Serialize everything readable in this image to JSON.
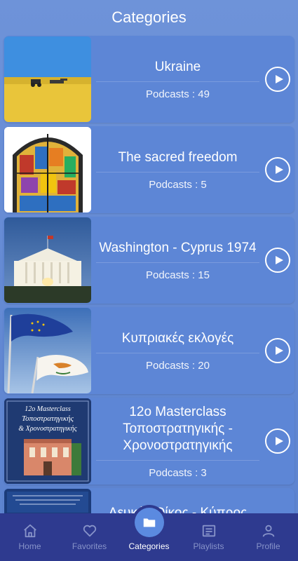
{
  "header": {
    "title": "Categories"
  },
  "categories": [
    {
      "title": "Ukraine",
      "count_label": "Podcasts : 49",
      "thumb": "ukraine-field"
    },
    {
      "title": "The sacred freedom",
      "count_label": "Podcasts : 5",
      "thumb": "stained-glass"
    },
    {
      "title": "Washington - Cyprus 1974",
      "count_label": "Podcasts : 15",
      "thumb": "white-house"
    },
    {
      "title": "Κυπριακές εκλογές",
      "count_label": "Podcasts : 20",
      "thumb": "flags"
    },
    {
      "title": "12ο Masterclass Τοποστρατηγικής - Χρονοστρατηγικής",
      "count_label": "Podcasts : 3",
      "thumb": "masterclass-cover",
      "thumb_text": {
        "line1": "12ο Masterclass",
        "line2": "Τοποστρατηγικής",
        "line3": "& Χρονοστρατηγικής"
      }
    },
    {
      "title": "Λευκός Οίκος - Κύπρος",
      "count_label": "",
      "thumb": "book-cover"
    }
  ],
  "nav": {
    "items": [
      {
        "label": "Home",
        "icon": "home-icon"
      },
      {
        "label": "Favorites",
        "icon": "heart-icon"
      },
      {
        "label": "Categories",
        "icon": "folder-icon"
      },
      {
        "label": "Playlists",
        "icon": "playlist-icon"
      },
      {
        "label": "Profile",
        "icon": "user-icon"
      }
    ],
    "active": "Categories"
  },
  "colors": {
    "background": "#6e93d9",
    "card": "#5d86d6",
    "nav_bar": "#2e3a8f",
    "nav_inactive": "#8793c9",
    "nav_active_fab": "#5b8ae0"
  }
}
